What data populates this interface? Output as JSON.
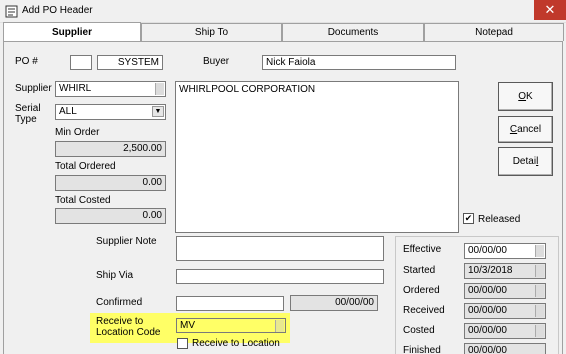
{
  "window": {
    "title": "Add PO Header",
    "close_glyph": "✕",
    "title_icon": "document-icon"
  },
  "tabs": [
    {
      "label": "Supplier",
      "active": true
    },
    {
      "label": "Ship To",
      "active": false
    },
    {
      "label": "Documents",
      "active": false
    },
    {
      "label": "Notepad",
      "active": false
    }
  ],
  "header": {
    "po_label": "PO #",
    "po_prefix": "",
    "po_number": "SYSTEM",
    "buyer_label": "Buyer",
    "buyer_value": "Nick Faiola"
  },
  "supplier": {
    "supplier_label": "Supplier",
    "supplier_code": "WHIRL",
    "supplier_name": "WHIRLPOOL CORPORATION",
    "serial_type_label": "Serial\nType",
    "serial_type_value": "ALL",
    "min_order_label": "Min Order",
    "min_order_value": "2,500.00",
    "total_ordered_label": "Total Ordered",
    "total_ordered_value": "0.00",
    "total_costed_label": "Total Costed",
    "total_costed_value": "0.00"
  },
  "buttons": {
    "ok": "OK",
    "cancel": "Cancel",
    "detail": "Detail"
  },
  "released": {
    "label": "Released",
    "checked": true,
    "mark": "✔"
  },
  "lower": {
    "supplier_note_label": "Supplier Note",
    "supplier_note_value": "",
    "ship_via_label": "Ship Via",
    "ship_via_value": "",
    "confirmed_label": "Confirmed",
    "confirmed_value": "",
    "confirmed_date": "00/00/00",
    "receive_label": "Receive to\nLocation Code",
    "receive_value": "MV",
    "receive_checkbox_label": "Receive to Location",
    "highlight_color": "#ffff66"
  },
  "dates": {
    "effective_label": "Effective",
    "effective_value": "00/00/00",
    "started_label": "Started",
    "started_value": "10/3/2018",
    "ordered_label": "Ordered",
    "ordered_value": "00/00/00",
    "received_label": "Received",
    "received_value": "00/00/00",
    "costed_label": "Costed",
    "costed_value": "00/00/00",
    "finished_label": "Finished",
    "finished_value": "00/00/00"
  }
}
